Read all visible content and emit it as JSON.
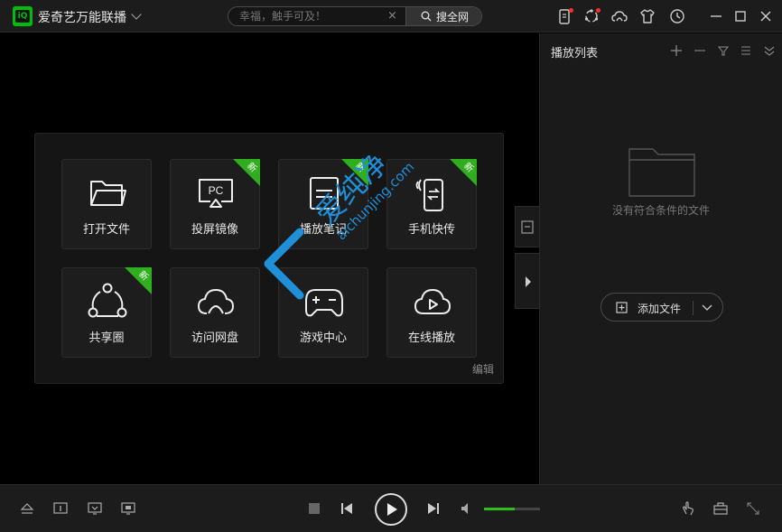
{
  "app": {
    "title": "爱奇艺万能联播",
    "logo_text": "iQ"
  },
  "search": {
    "placeholder": "幸福，触手可及！",
    "clear_symbol": "×",
    "button_label": "搜全网"
  },
  "window_controls": [
    "minimize",
    "maximize",
    "close"
  ],
  "tiles": [
    {
      "label": "打开文件",
      "icon": "folder-icon",
      "badge": ""
    },
    {
      "label": "投屏镜像",
      "icon": "screen-cast-icon",
      "icon_text": "PC",
      "badge": "新"
    },
    {
      "label": "播放笔记",
      "icon": "notes-icon",
      "badge": "新"
    },
    {
      "label": "手机快传",
      "icon": "phone-transfer-icon",
      "badge": "新"
    },
    {
      "label": "共享圈",
      "icon": "share-circle-icon",
      "badge": "新"
    },
    {
      "label": "访问网盘",
      "icon": "cloud-drive-icon",
      "badge": ""
    },
    {
      "label": "游戏中心",
      "icon": "gamepad-icon",
      "badge": ""
    },
    {
      "label": "在线播放",
      "icon": "cloud-play-icon",
      "badge": ""
    }
  ],
  "panel": {
    "edit_label": "编辑"
  },
  "watermark": {
    "text_main": "爱纯净",
    "text_url": "aichunjing.com"
  },
  "playlist": {
    "title": "播放列表",
    "empty_text": "没有符合条件的文件",
    "add_button_label": "添加文件"
  },
  "player": {
    "volume_level": 0.55
  },
  "colors": {
    "accent": "#2fbf1a",
    "badge": "#2fae1e",
    "background": "#000000",
    "panel": "#151515"
  }
}
